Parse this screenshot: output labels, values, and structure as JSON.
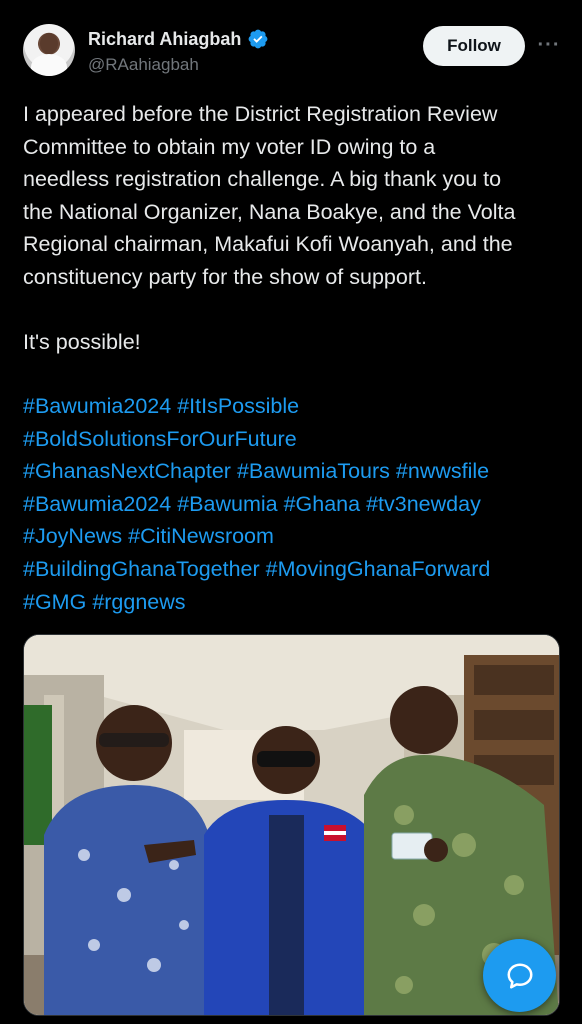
{
  "author": {
    "display_name": "Richard Ahiagbah",
    "handle": "@RAahiagbah",
    "verified_icon": "verified-badge-icon"
  },
  "actions": {
    "follow_label": "Follow",
    "more_label": "···"
  },
  "tweet": {
    "lines": [
      "I appeared before the District Registration Review",
      "Committee to obtain my voter ID owing to a",
      "needless registration challenge. A big thank you to",
      "the National Organizer, Nana Boakye, and the Volta",
      "Regional chairman, Makafui Kofi Woanyah, and the",
      "constituency party for the show of support."
    ],
    "closing": "It's possible!",
    "hashtag_lines": [
      [
        "#Bawumia2024",
        "#ItIsPossible"
      ],
      [
        "#BoldSolutionsForOurFuture"
      ],
      [
        "#GhanasNextChapter",
        "#BawumiaTours",
        "#nwwsfile"
      ],
      [
        "#Bawumia2024",
        "#Bawumia",
        "#Ghana",
        "#tv3newday"
      ],
      [
        "#JoyNews",
        "#CitiNewsroom"
      ],
      [
        "#BuildingGhanaTogether",
        "#MovingGhanaForward"
      ],
      [
        "#GMG",
        "#rggnews"
      ]
    ]
  },
  "colors": {
    "background": "#000000",
    "text": "#e7e9ea",
    "muted": "#71767b",
    "link": "#1d9bf0"
  },
  "fab": {
    "icon": "chat-bubble-icon"
  }
}
